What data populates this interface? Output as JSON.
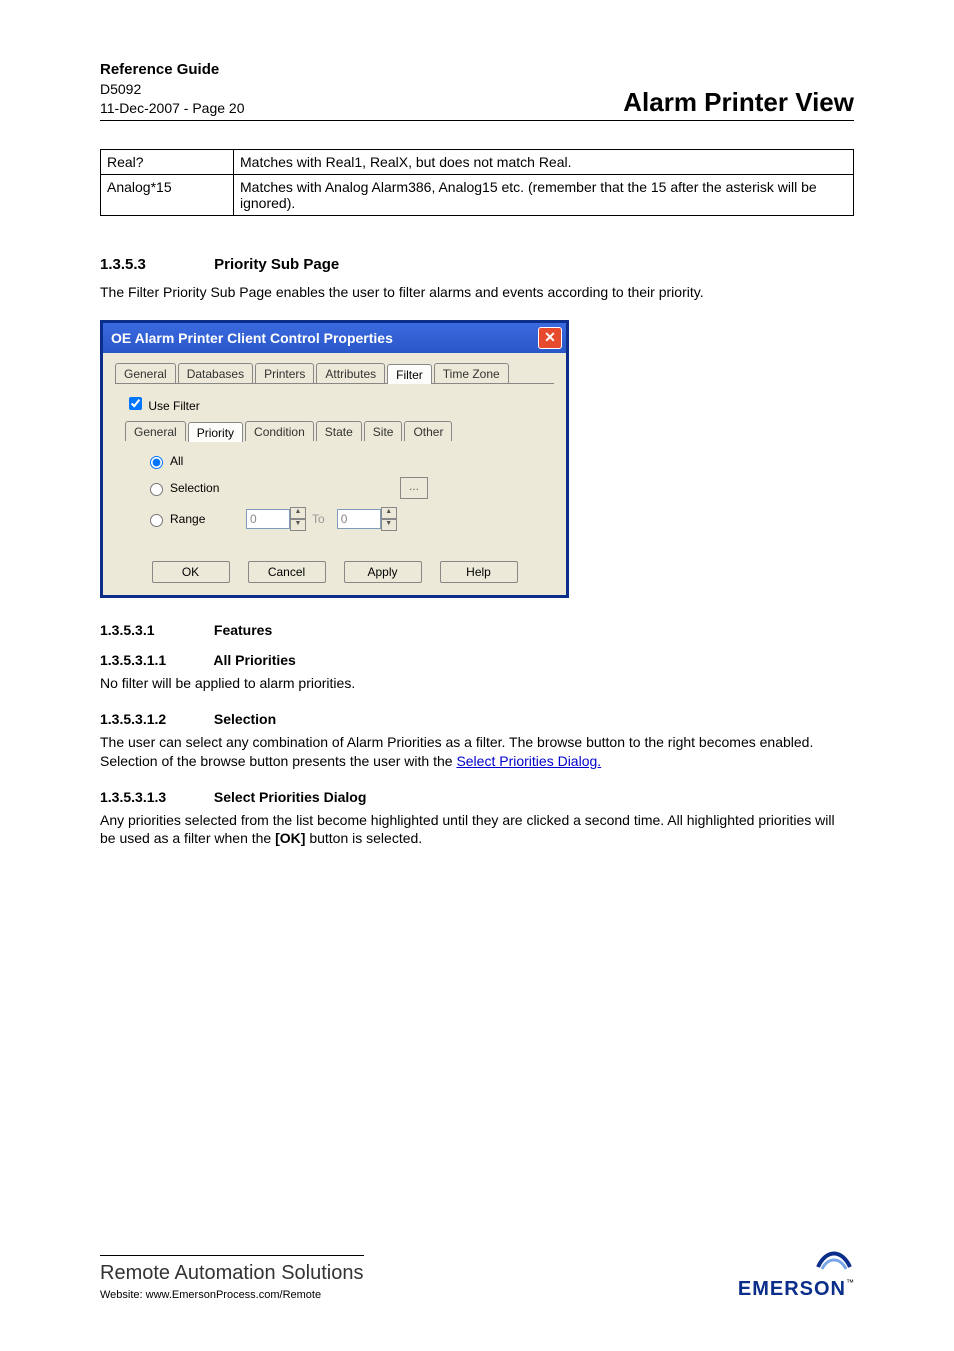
{
  "header": {
    "doc_title": "Reference Guide",
    "doc_id": "D5092",
    "date_page": "11-Dec-2007 - Page 20",
    "view_title": "Alarm Printer View"
  },
  "example_table": [
    {
      "key": "Real?",
      "desc": "Matches with Real1, RealX, but does not match Real."
    },
    {
      "key": "Analog*15",
      "desc": "Matches with Analog Alarm386, Analog15 etc. (remember that the 15 after the asterisk will be ignored)."
    }
  ],
  "sections": {
    "s1": {
      "num": "1.3.5.3",
      "title": "Priority Sub Page"
    },
    "s1_body": "The Filter Priority Sub Page enables the user to filter alarms and events according to their priority.",
    "s2": {
      "num": "1.3.5.3.1",
      "title": "Features"
    },
    "s3": {
      "num": "1.3.5.3.1.1",
      "title": "All Priorities"
    },
    "s3_body": "No filter will be applied to alarm priorities.",
    "s4": {
      "num": "1.3.5.3.1.2",
      "title": "Selection"
    },
    "s4_body_pre": "The user can select any combination of Alarm Priorities as a filter. The browse button to the right becomes enabled. Selection of the browse button presents the user with the ",
    "s4_link": "Select Priorities Dialog.",
    "s5": {
      "num": "1.3.5.3.1.3",
      "title": "Select Priorities Dialog"
    },
    "s5_body_a": "Any priorities selected from the list become highlighted until they are clicked a second time. All highlighted priorities will be used as a filter when the ",
    "s5_bold": "[OK]",
    "s5_body_b": " button is selected."
  },
  "dialog": {
    "title": "OE Alarm Printer Client Control Properties",
    "close": "✕",
    "tabs": [
      "General",
      "Databases",
      "Printers",
      "Attributes",
      "Filter",
      "Time Zone"
    ],
    "active_tab": "Filter",
    "use_filter_label": "Use Filter",
    "use_filter_checked": true,
    "subtabs": [
      "General",
      "Priority",
      "Condition",
      "State",
      "Site",
      "Other"
    ],
    "active_subtab": "Priority",
    "radios": {
      "all": "All",
      "selection": "Selection",
      "range": "Range"
    },
    "selected_radio": "all",
    "browse": "...",
    "range_from": "0",
    "range_to_label": "To",
    "range_to": "0",
    "buttons": {
      "ok": "OK",
      "cancel": "Cancel",
      "apply": "Apply",
      "help": "Help"
    }
  },
  "footer": {
    "ras": "Remote Automation Solutions",
    "site_label": "Website:  www.EmersonProcess.com/Remote",
    "brand": "EMERSON",
    "tm": "™"
  }
}
